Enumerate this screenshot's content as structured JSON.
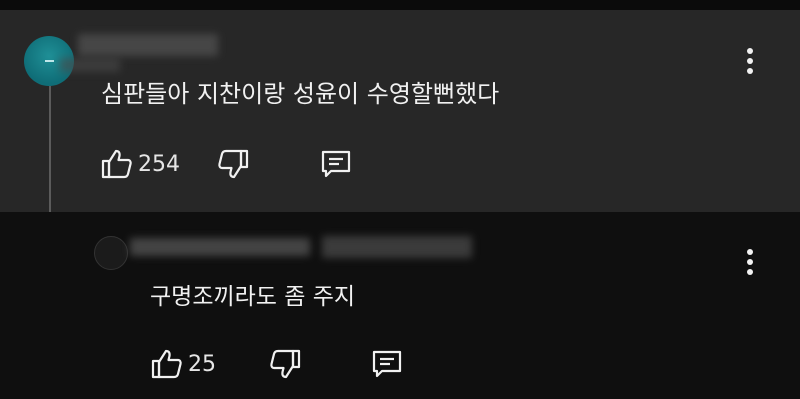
{
  "comment": {
    "text": "심판들아 지찬이랑 성윤이 수영할뻔했다",
    "likes": "254"
  },
  "reply": {
    "text": "구명조끼라도 좀 주지",
    "likes": "25"
  },
  "icons": {
    "like": "thumb-up-icon",
    "dislike": "thumb-down-icon",
    "reply": "reply-comment-icon",
    "more": "more-vert-icon"
  },
  "colors": {
    "comment_bg": "#272727",
    "page_bg": "#0f0f0f",
    "avatar": "#117a84",
    "text": "#f1f1f1"
  }
}
